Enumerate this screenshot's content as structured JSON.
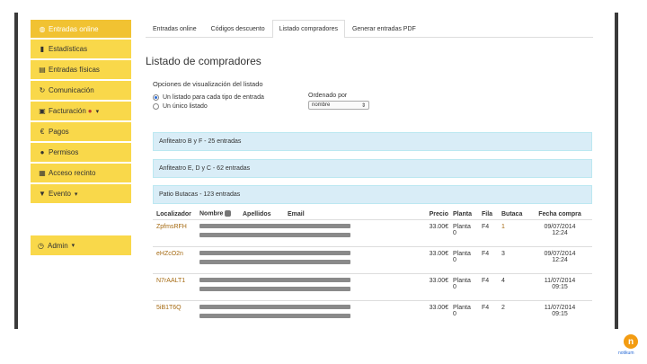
{
  "sidebar": {
    "items": [
      {
        "label": "Entradas online",
        "icon": "globe-icon"
      },
      {
        "label": "Estadísticas",
        "icon": "bar-chart-icon"
      },
      {
        "label": "Entradas físicas",
        "icon": "file-icon"
      },
      {
        "label": "Comunicación",
        "icon": "refresh-icon"
      },
      {
        "label": "Facturación",
        "icon": "briefcase-icon"
      },
      {
        "label": "Pagos",
        "icon": "euro-icon"
      },
      {
        "label": "Permisos",
        "icon": "user-icon"
      },
      {
        "label": "Acceso recinto",
        "icon": "qr-icon"
      },
      {
        "label": "Evento",
        "icon": "bookmark-icon"
      }
    ],
    "admin_label": "Admin"
  },
  "tabs": [
    {
      "label": "Entradas online"
    },
    {
      "label": "Códigos descuento"
    },
    {
      "label": "Listado compradores"
    },
    {
      "label": "Generar entradas PDF"
    }
  ],
  "page_title": "Listado de compradores",
  "options": {
    "title": "Opciones de visualización del listado",
    "radio1": "Un listado para cada tipo de entrada",
    "radio2": "Un único listado",
    "order_label": "Ordenado por",
    "order_value": "nombre"
  },
  "groups": [
    "Anfiteatro B y F - 25 entradas",
    "Anfiteatro E, D y C - 62 entradas",
    "Patio Butacas - 123 entradas"
  ],
  "table": {
    "headers": {
      "localizador": "Localizador",
      "nombre": "Nombre",
      "apellidos": "Apellidos",
      "email": "Email",
      "precio": "Precio",
      "planta": "Planta",
      "fila": "Fila",
      "butaca": "Butaca",
      "fecha": "Fecha compra"
    },
    "rows": [
      {
        "loc": "ZpfmsRFH",
        "precio": "33.00€",
        "planta": "Planta",
        "planta2": "0",
        "fila": "F4",
        "butaca": "1",
        "fecha": "09/07/2014",
        "hora": "12:24"
      },
      {
        "loc": "eHZcO2n",
        "precio": "33.00€",
        "planta": "Planta",
        "planta2": "0",
        "fila": "F4",
        "butaca": "3",
        "fecha": "09/07/2014",
        "hora": "12:24"
      },
      {
        "loc": "N7rAALT1",
        "precio": "33.00€",
        "planta": "Planta",
        "planta2": "0",
        "fila": "F4",
        "butaca": "4",
        "fecha": "11/07/2014",
        "hora": "09:15"
      },
      {
        "loc": "5iB1T6Q",
        "precio": "33.00€",
        "planta": "Planta",
        "planta2": "0",
        "fila": "F4",
        "butaca": "2",
        "fecha": "11/07/2014",
        "hora": "09:15"
      }
    ]
  },
  "logo_text": "notikum"
}
